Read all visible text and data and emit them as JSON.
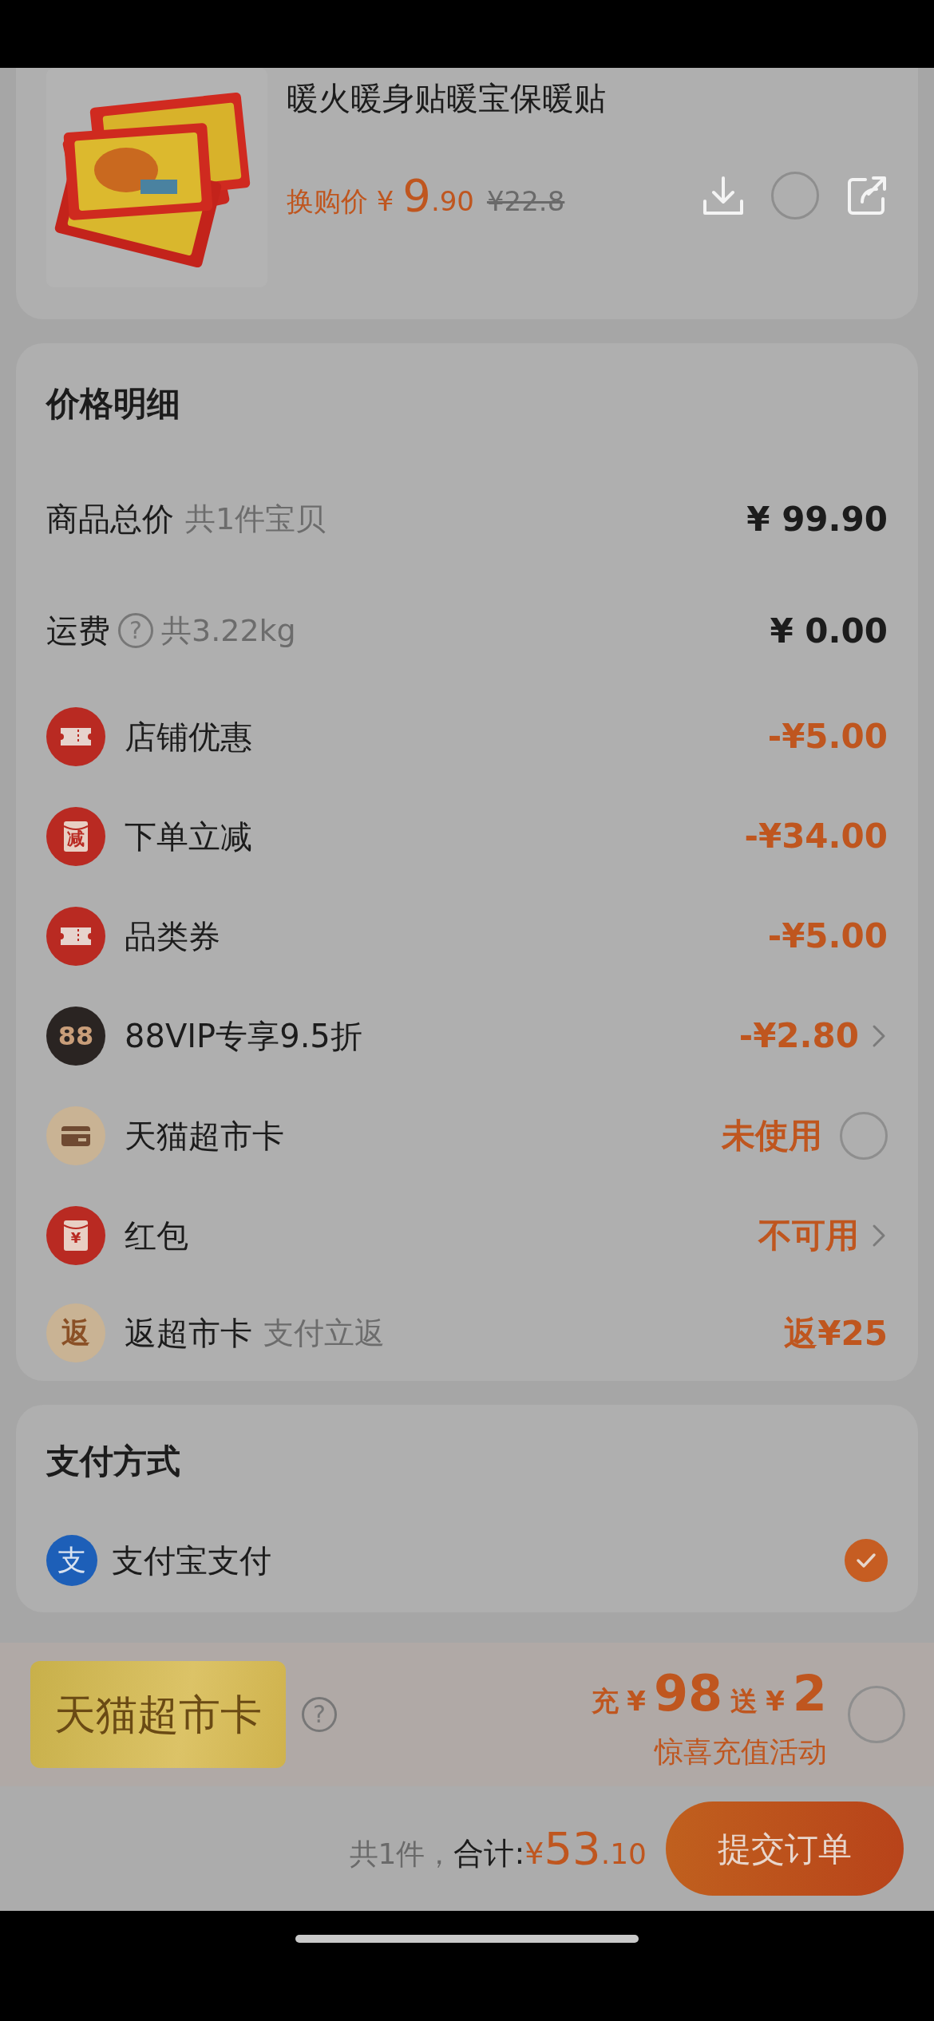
{
  "product": {
    "title": "暖火暖身贴暖宝保暖贴",
    "price_label": "换购价",
    "currency": "¥",
    "price_int": "9",
    "price_dec": ".90",
    "original_price": "¥22.8",
    "checked": false
  },
  "price_detail": {
    "title": "价格明细",
    "rows": [
      {
        "kind": "total",
        "label": "商品总价",
        "note": "共1件宝贝",
        "value": "¥ 99.90"
      },
      {
        "kind": "shipping",
        "label": "运费",
        "help": "?",
        "note": "共3.22kg",
        "value": "¥ 0.00"
      },
      {
        "kind": "coupon",
        "label": "店铺优惠",
        "value": "-¥5.00"
      },
      {
        "kind": "instant",
        "icon_text": "减",
        "label": "下单立减",
        "value": "-¥34.00"
      },
      {
        "kind": "coupon",
        "label": "品类券",
        "value": "-¥5.00"
      },
      {
        "kind": "vip",
        "icon_text": "88",
        "label": "88VIP专享9.5折",
        "value": "-¥2.80"
      },
      {
        "kind": "card",
        "label": "天猫超市卡",
        "value": "未使用",
        "checked": false
      },
      {
        "kind": "redpacket",
        "icon_text": "¥",
        "label": "红包",
        "value": "不可用"
      },
      {
        "kind": "rebate",
        "icon_text": "返",
        "label": "返超市卡",
        "note": "支付立返",
        "value": "返¥25"
      }
    ]
  },
  "payment": {
    "title": "支付方式",
    "methods": [
      {
        "icon_text": "支",
        "name": "支付宝支付",
        "selected": true
      }
    ]
  },
  "topup": {
    "card_label": "天猫超市卡",
    "help": "?",
    "give_label": "充",
    "give_currency": "¥",
    "give_amount": "98",
    "bonus_label": "送",
    "bonus_currency": "¥",
    "bonus_amount": "2",
    "subtitle": "惊喜充值活动",
    "checked": false
  },
  "footer": {
    "count": "共1件，",
    "total_label": "合计:",
    "currency": "¥",
    "total_int": "53",
    "total_dec": ".10",
    "submit": "提交订单"
  }
}
